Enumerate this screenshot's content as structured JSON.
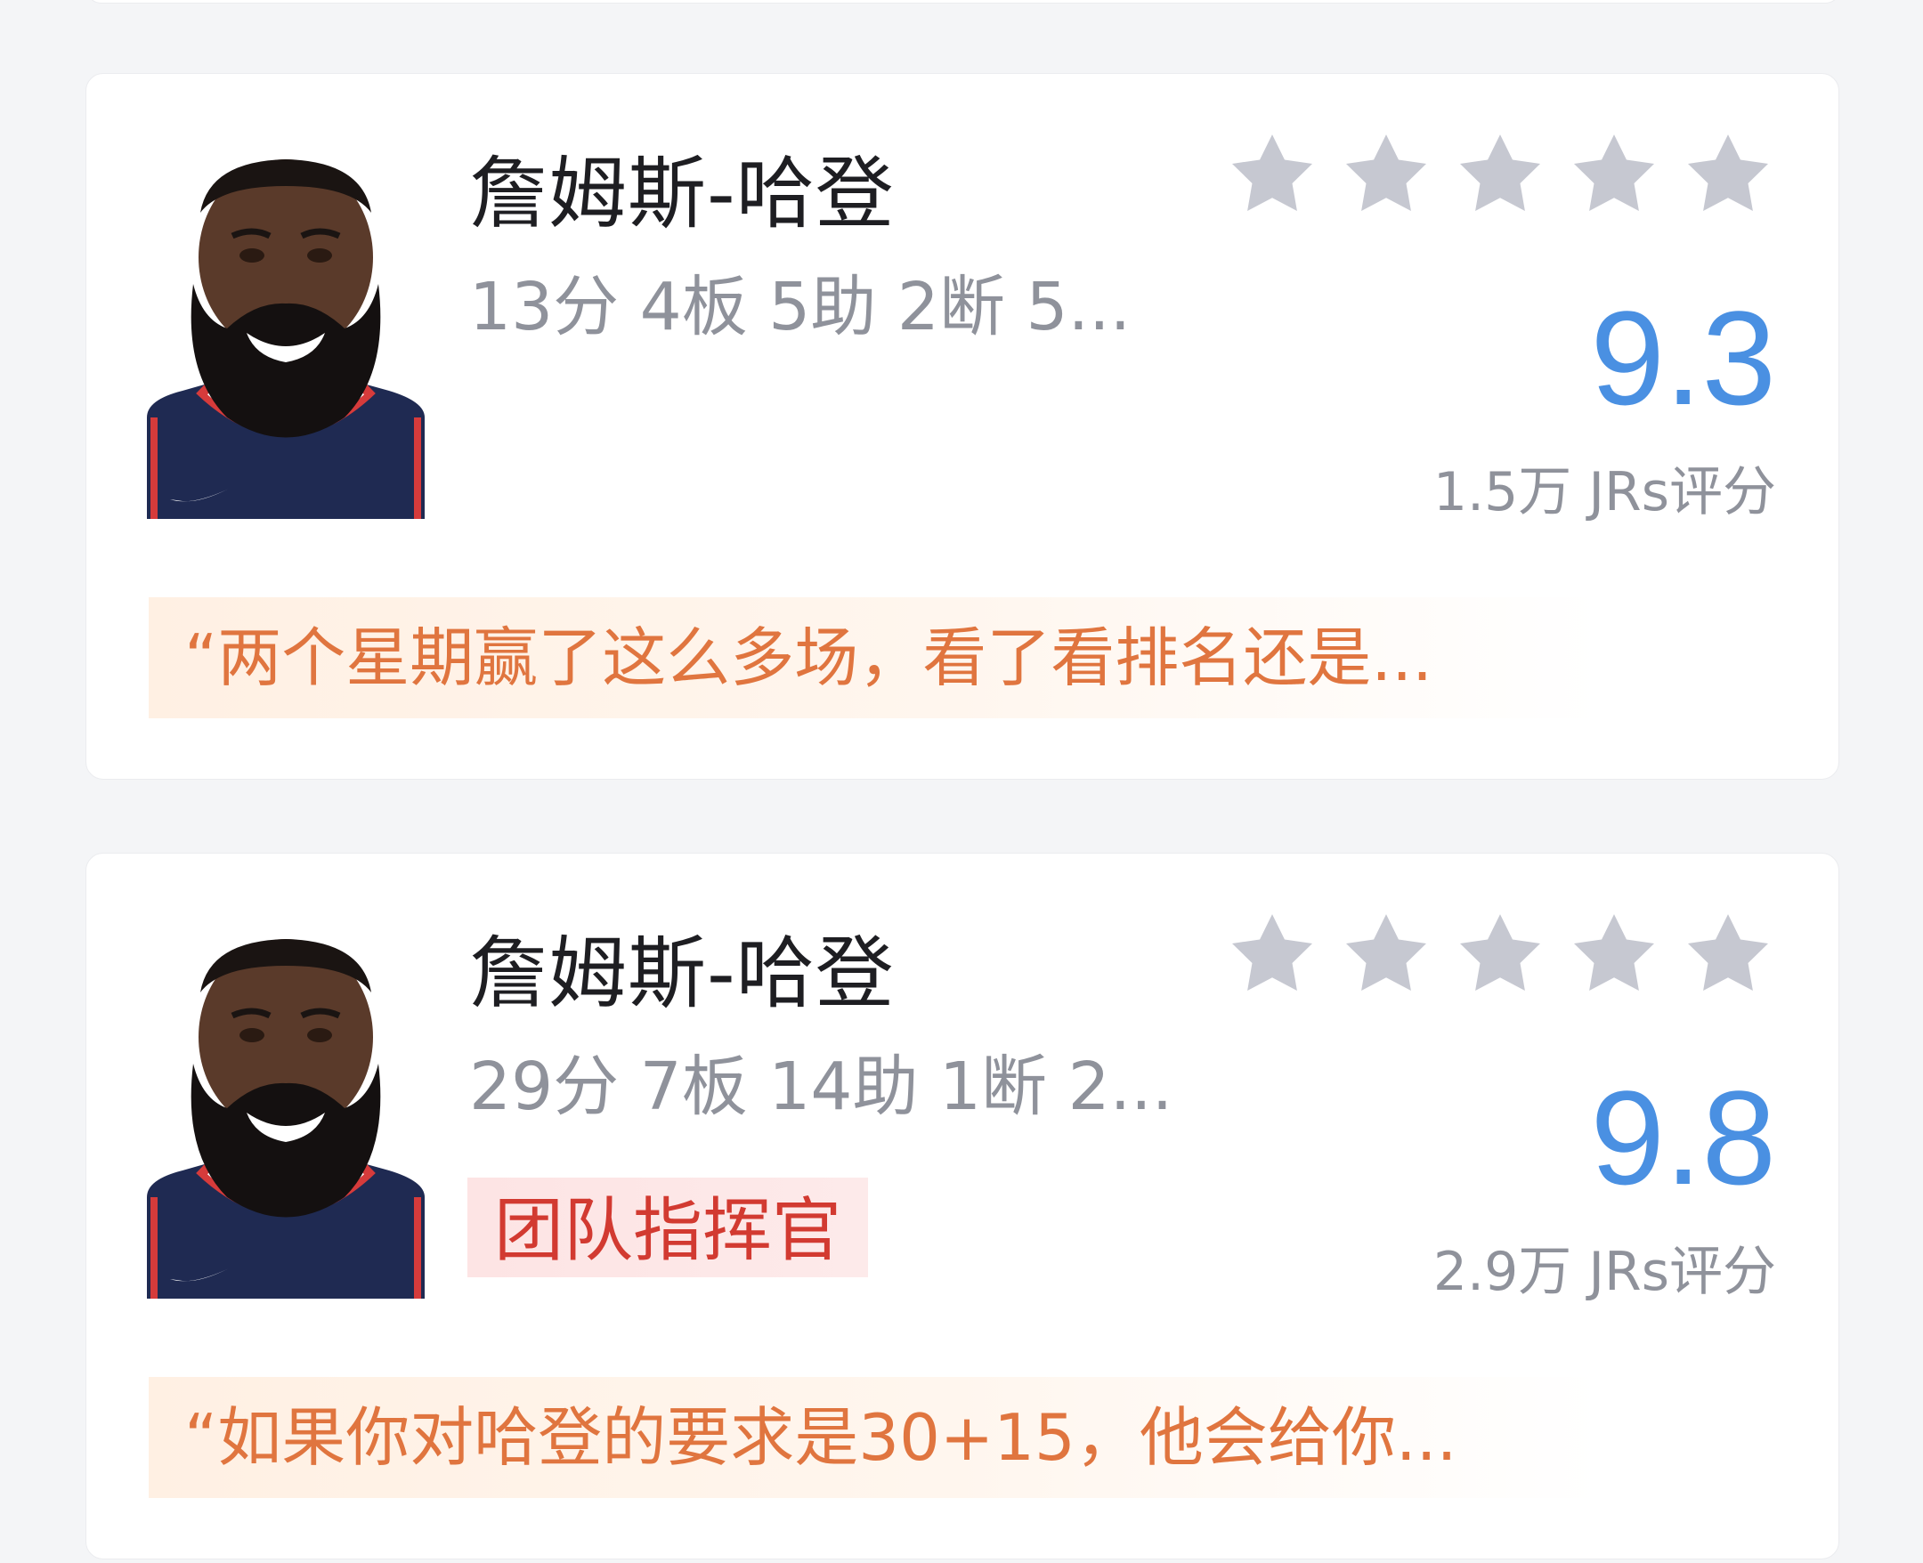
{
  "cards": [
    {
      "player_name": "詹姆斯-哈登",
      "stats": "13分 4板 5助 2断 5...",
      "tag": "",
      "score": "9.3",
      "rating_count": "1.5万 JRs评分",
      "comment": "“两个星期赢了这么多场，看了看排名还是...",
      "stars_filled": 0,
      "stars_total": 5
    },
    {
      "player_name": "詹姆斯-哈登",
      "stats": "29分 7板 14助 1断 2...",
      "tag": "团队指挥官",
      "score": "9.8",
      "rating_count": "2.9万 JRs评分",
      "comment": "“如果你对哈登的要求是30+15，他会给你...",
      "stars_filled": 0,
      "stars_total": 5
    }
  ],
  "icons": {
    "star": "star-icon",
    "avatar": "player-avatar"
  },
  "colors": {
    "score_blue": "#4a90e2",
    "star_gray": "#c6c8d1",
    "comment_orange": "#e0753f",
    "tag_red": "#d23a31",
    "stats_gray": "#8f929b"
  }
}
